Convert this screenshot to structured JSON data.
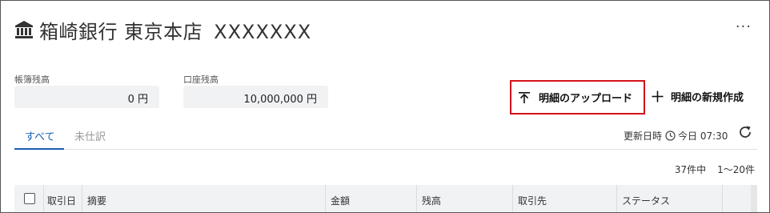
{
  "header": {
    "bank_name": "箱崎銀行 東京本店",
    "account": "XXXXXXX",
    "icon": "bank-icon",
    "more_label": "···"
  },
  "balances": {
    "book": {
      "label": "帳簿残高",
      "value": "0 円"
    },
    "account": {
      "label": "口座残高",
      "value": "10,000,000 円"
    }
  },
  "actions": {
    "upload_label": "明細のアップロード",
    "new_label": "明細の新規作成",
    "highlight_color": "#d0121b"
  },
  "tabs": [
    {
      "label": "すべて",
      "active": true
    },
    {
      "label": "未仕訳",
      "active": false
    }
  ],
  "status": {
    "updated_label": "更新日時",
    "updated_value": "今日 07:30"
  },
  "pagination": {
    "total": "37件中",
    "range": "1〜20件"
  },
  "table": {
    "columns": [
      "取引日",
      "摘要",
      "金額",
      "残高",
      "取引先",
      "ステータス"
    ]
  },
  "colors": {
    "accent": "#1a5fb4",
    "muted_tab": "#999999",
    "box_bg": "#f1f2f4"
  }
}
